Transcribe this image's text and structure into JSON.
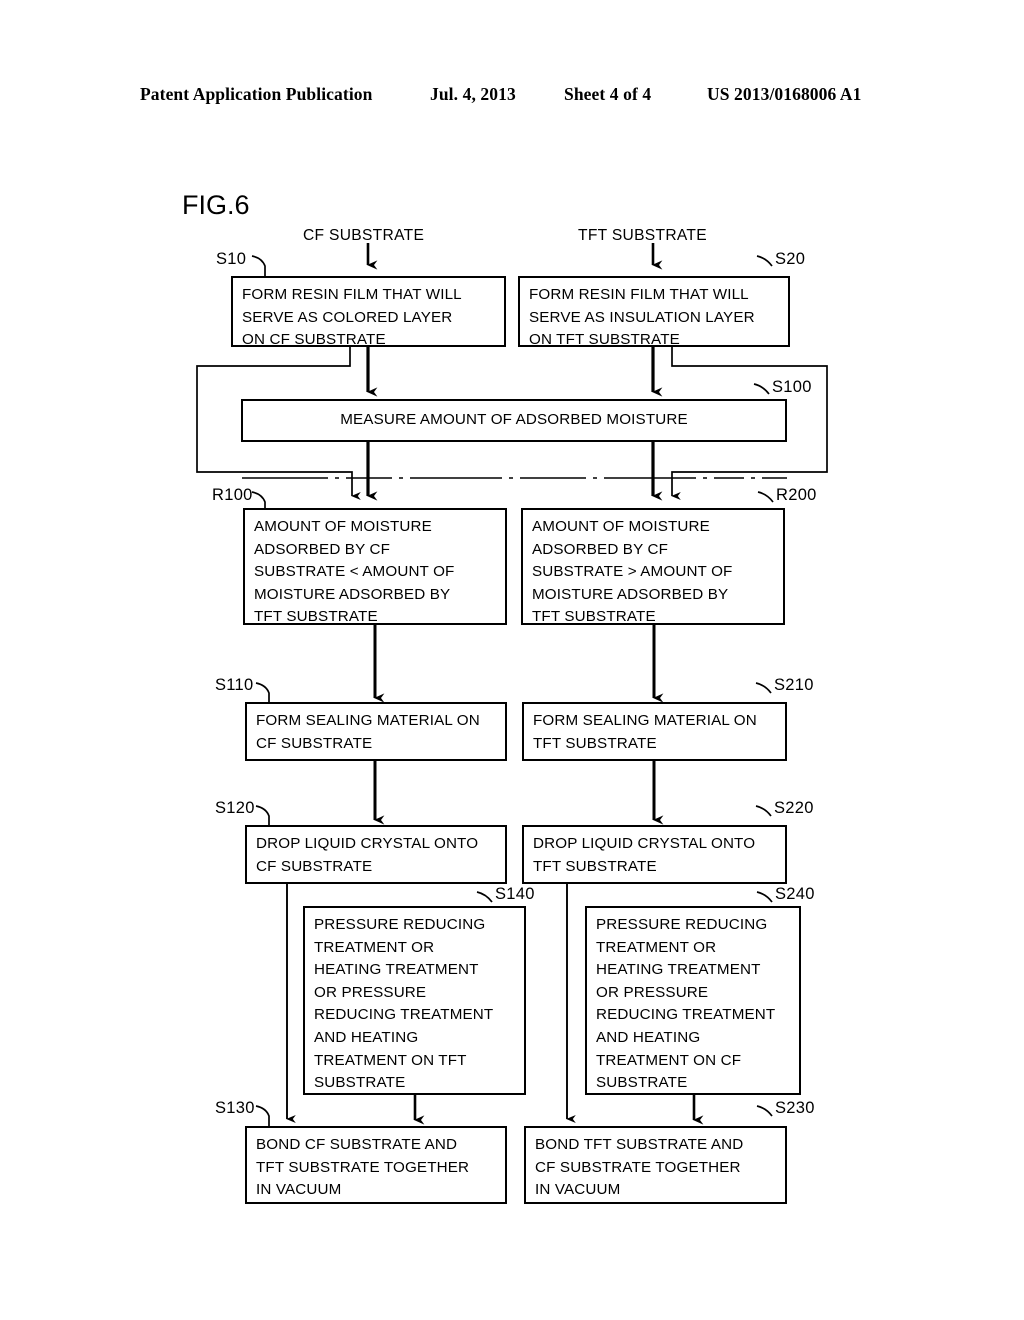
{
  "header": {
    "publication": "Patent Application Publication",
    "date": "Jul. 4, 2013",
    "sheet": "Sheet 4 of 4",
    "number": "US 2013/0168006 A1"
  },
  "figure": {
    "title": "FIG.6",
    "column_labels": {
      "left": "CF SUBSTRATE",
      "right": "TFT SUBSTRATE"
    },
    "step_refs": {
      "s10": "S10",
      "s20": "S20",
      "s100": "S100",
      "r100": "R100",
      "r200": "R200",
      "s110": "S110",
      "s210": "S210",
      "s120": "S120",
      "s220": "S220",
      "s140": "S140",
      "s240": "S240",
      "s130": "S130",
      "s230": "S230"
    },
    "boxes": {
      "s10": "FORM RESIN FILM THAT WILL\nSERVE AS COLORED LAYER\nON CF SUBSTRATE",
      "s20": "FORM RESIN FILM THAT WILL\nSERVE AS INSULATION LAYER\nON TFT SUBSTRATE",
      "s100": "MEASURE AMOUNT OF ADSORBED MOISTURE",
      "r100": "AMOUNT OF MOISTURE\nADSORBED BY CF\nSUBSTRATE < AMOUNT OF\nMOISTURE ADSORBED BY\nTFT SUBSTRATE",
      "r200": "AMOUNT OF MOISTURE\nADSORBED BY CF\nSUBSTRATE > AMOUNT OF\nMOISTURE ADSORBED BY\nTFT SUBSTRATE",
      "s110": "FORM SEALING MATERIAL ON\nCF SUBSTRATE",
      "s210": "FORM SEALING MATERIAL ON\nTFT SUBSTRATE",
      "s120": "DROP LIQUID CRYSTAL ONTO\nCF SUBSTRATE",
      "s220": "DROP LIQUID CRYSTAL ONTO\nTFT SUBSTRATE",
      "s140": "PRESSURE REDUCING\nTREATMENT OR\nHEATING TREATMENT\nOR PRESSURE\nREDUCING TREATMENT\nAND HEATING\nTREATMENT ON TFT\nSUBSTRATE",
      "s240": "PRESSURE REDUCING\nTREATMENT OR\nHEATING TREATMENT\nOR PRESSURE\nREDUCING TREATMENT\nAND HEATING\nTREATMENT ON CF\nSUBSTRATE",
      "s130": "BOND CF SUBSTRATE AND\nTFT SUBSTRATE TOGETHER\nIN VACUUM",
      "s230": "BOND TFT SUBSTRATE AND\nCF SUBSTRATE TOGETHER\nIN VACUUM"
    },
    "colors": {
      "ink": "#000000",
      "paper": "#ffffff"
    }
  }
}
